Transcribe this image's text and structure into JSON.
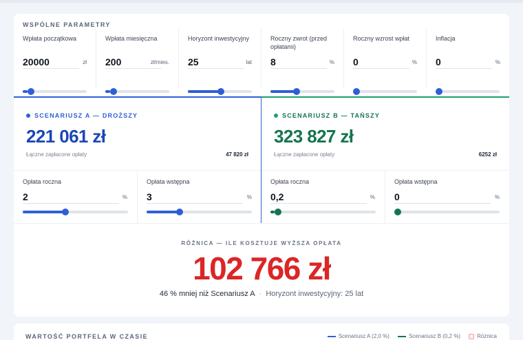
{
  "shared": {
    "title": "WSPÓLNE PARAMETRY",
    "params": [
      {
        "label": "Wpłata początkowa",
        "value": "20000",
        "unit": "zł",
        "fill": 0.08
      },
      {
        "label": "Wpłata miesięczna",
        "value": "200",
        "unit": "zł/mies.",
        "fill": 0.08
      },
      {
        "label": "Horyzont inwestycyjny",
        "value": "25",
        "unit": "lat",
        "fill": 0.52
      },
      {
        "label": "Roczny zwrot (przed opłatami)",
        "value": "8",
        "unit": "%",
        "fill": 0.4
      },
      {
        "label": "Roczny wzrost wpłat",
        "value": "0",
        "unit": "%",
        "fill": 0.0
      },
      {
        "label": "Inflacja",
        "value": "0",
        "unit": "%",
        "fill": 0.0
      }
    ]
  },
  "scenario_a": {
    "title": "SCENARIUSZ A — DROŻSZY",
    "total": "221 061 zł",
    "fees_label": "Łączne zapłacone opłaty",
    "fees_value": "47 820 zł",
    "color": "#2f5fd6",
    "annual_fee": {
      "label": "Opłata roczna",
      "value": "2",
      "unit": "%",
      "fill": 0.4
    },
    "entry_fee": {
      "label": "Opłata wstępna",
      "value": "3",
      "unit": "%",
      "fill": 0.3
    }
  },
  "scenario_b": {
    "title": "SCENARIUSZ B — TAŃSZY",
    "total": "323 827 zł",
    "fees_label": "Łączne zapłacone opłaty",
    "fees_value": "6252 zł",
    "color": "#15744f",
    "annual_fee": {
      "label": "Opłata roczna",
      "value": "0,2",
      "unit": "%",
      "fill": 0.04
    },
    "entry_fee": {
      "label": "Opłata wstępna",
      "value": "0",
      "unit": "%",
      "fill": 0.0
    }
  },
  "difference": {
    "title": "RÓŻNICA — ILE KOSZTUJE WYŻSZA OPŁATA",
    "value": "102 766 zł",
    "note": "46 % mniej niż Scenariusz A",
    "horizon": "Horyzont inwestycyjny: 25 lat",
    "color": "#dc2626"
  },
  "chart": {
    "title": "WARTOŚĆ PORTFELA W CZASIE",
    "legend": [
      {
        "label": "Scenariusz A (2,0 %)",
        "color": "#2f5fd6"
      },
      {
        "label": "Scenariusz B (0,2 %)",
        "color": "#15744f"
      },
      {
        "label": "Różnica",
        "color": "#f0a0a0"
      }
    ]
  }
}
